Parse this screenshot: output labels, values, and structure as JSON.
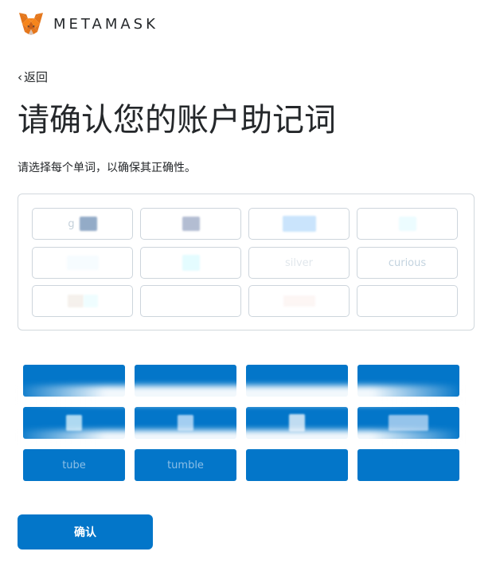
{
  "header": {
    "brand": "METAMASK",
    "logo_icon": "metamask-fox-icon"
  },
  "nav": {
    "back_label": "返回"
  },
  "page": {
    "title": "请确认您的账户助记词",
    "subtitle": "请选择每个单词，以确保其正确性。"
  },
  "selected_words": {
    "slots": [
      {
        "text": "g"
      },
      {
        "text": ""
      },
      {
        "text": ""
      },
      {
        "text": ""
      },
      {
        "text": ""
      },
      {
        "text": ""
      },
      {
        "text": "silver"
      },
      {
        "text": "curious"
      },
      {
        "text": ""
      },
      {
        "text": ""
      },
      {
        "text": ""
      },
      {
        "text": ""
      }
    ]
  },
  "word_choices": {
    "items": [
      {
        "label": ""
      },
      {
        "label": ""
      },
      {
        "label": ""
      },
      {
        "label": ""
      },
      {
        "label": ""
      },
      {
        "label": ""
      },
      {
        "label": ""
      },
      {
        "label": ""
      },
      {
        "label": "tube"
      },
      {
        "label": "tumble"
      },
      {
        "label": ""
      },
      {
        "label": ""
      }
    ]
  },
  "footer": {
    "confirm_label": "确认"
  },
  "colors": {
    "primary": "#0376c9",
    "text": "#24272a",
    "border": "#d2d8dd"
  }
}
